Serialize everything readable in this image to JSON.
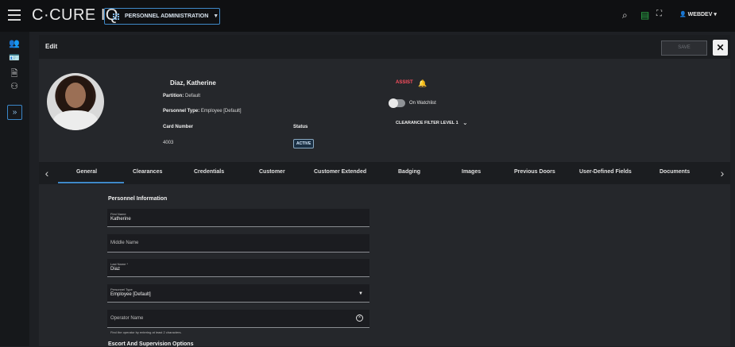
{
  "topbar": {
    "brand": "C·CURE IQ",
    "app_select_label": "PERSONNEL ADMINISTRATION",
    "user_label": "WEBDEV"
  },
  "edit": {
    "title": "Edit",
    "save_label": "SAVE",
    "close_label": "✕"
  },
  "person": {
    "name": "Diaz, Katherine",
    "partition_label": "Partition:",
    "partition_value": "Default",
    "type_label": "Personnel Type:",
    "type_value": "Employee [Default]",
    "card_number_label": "Card Number",
    "card_number_value": "4003",
    "status_label": "Status",
    "status_value": "ACTIVE"
  },
  "side_info": {
    "assist_label": "ASSIST",
    "watchlist_label": "On Watchlist",
    "clearance_filter_label": "CLEARANCE FILTER LEVEL 1"
  },
  "tabs": [
    {
      "label": "General"
    },
    {
      "label": "Clearances"
    },
    {
      "label": "Credentials"
    },
    {
      "label": "Customer"
    },
    {
      "label": "Customer Extended"
    },
    {
      "label": "Badging"
    },
    {
      "label": "Images"
    },
    {
      "label": "Previous Doors"
    },
    {
      "label": "User-Defined Fields"
    },
    {
      "label": "Documents"
    }
  ],
  "form": {
    "section_title": "Personnel Information",
    "first_name_label": "First Name",
    "first_name_value": "Katherine",
    "middle_name_placeholder": "Middle Name",
    "last_name_label": "Last Name *",
    "last_name_value": "Diaz",
    "personnel_type_label": "Personnel Type",
    "personnel_type_value": "Employee [Default]",
    "operator_name_placeholder": "Operator Name",
    "operator_hint": "Find the operator by entering at least 2 characters.",
    "escort_title": "Escort And Supervision Options"
  },
  "colors": {
    "accent": "#3f89c8",
    "alert": "#ff4f5f",
    "watchlist_icon": "#2db34a"
  }
}
